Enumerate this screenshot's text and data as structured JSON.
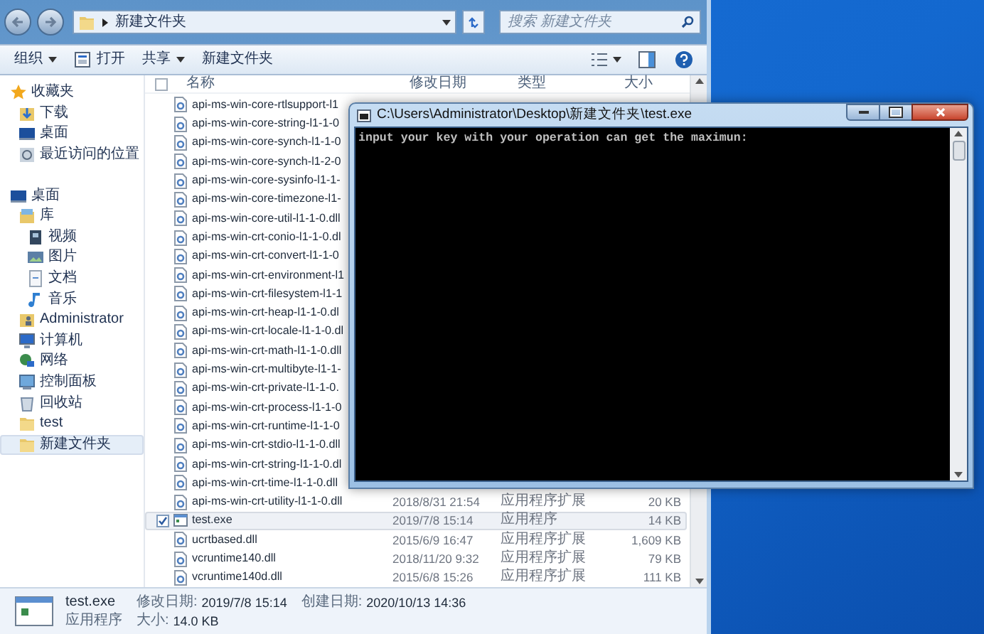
{
  "explorer": {
    "address": {
      "path": [
        "新建文件夹"
      ]
    },
    "search": {
      "placeholder": "搜索 新建文件夹"
    },
    "toolbar": [
      {
        "label": "组织",
        "kind": "menu"
      },
      {
        "label": "打开",
        "kind": "open"
      },
      {
        "label": "共享",
        "kind": "menu"
      },
      {
        "label": "新建文件夹",
        "kind": "plain"
      }
    ],
    "sidebar": [
      {
        "label": "收藏夹",
        "kind": "favorites",
        "selected": false,
        "children": [
          {
            "label": "下载",
            "kind": "downloads",
            "selected": false
          },
          {
            "label": "桌面",
            "kind": "desktop",
            "selected": false
          },
          {
            "label": "最近访问的位置",
            "kind": "recent",
            "selected": false
          }
        ]
      },
      {
        "label": "桌面",
        "kind": "desktop",
        "selected": false,
        "children": [
          {
            "label": "库",
            "kind": "libraries",
            "selected": false,
            "children": [
              {
                "label": "视频",
                "kind": "videos",
                "selected": false
              },
              {
                "label": "图片",
                "kind": "pictures",
                "selected": false
              },
              {
                "label": "文档",
                "kind": "documents",
                "selected": false
              },
              {
                "label": "音乐",
                "kind": "music",
                "selected": false
              }
            ]
          },
          {
            "label": "Administrator",
            "kind": "user",
            "selected": false
          },
          {
            "label": "计算机",
            "kind": "computer",
            "selected": false
          },
          {
            "label": "网络",
            "kind": "network",
            "selected": false
          },
          {
            "label": "控制面板",
            "kind": "control_panel",
            "selected": false
          },
          {
            "label": "回收站",
            "kind": "recycle_bin",
            "selected": false
          },
          {
            "label": "test",
            "kind": "folder",
            "selected": false
          },
          {
            "label": "新建文件夹",
            "kind": "folder",
            "selected": true
          }
        ]
      }
    ],
    "select_all": {
      "checked": false
    },
    "columns": [
      "名称",
      "修改日期",
      "类型",
      "大小"
    ],
    "rows": [
      {
        "name": "api-ms-win-core-rtlsupport-l1",
        "kind": "dll",
        "selected": false
      },
      {
        "name": "api-ms-win-core-string-l1-1-0",
        "kind": "dll",
        "selected": false
      },
      {
        "name": "api-ms-win-core-synch-l1-1-0",
        "kind": "dll",
        "selected": false
      },
      {
        "name": "api-ms-win-core-synch-l1-2-0",
        "kind": "dll",
        "selected": false
      },
      {
        "name": "api-ms-win-core-sysinfo-l1-1-",
        "kind": "dll",
        "selected": false
      },
      {
        "name": "api-ms-win-core-timezone-l1-",
        "kind": "dll",
        "selected": false
      },
      {
        "name": "api-ms-win-core-util-l1-1-0.dll",
        "kind": "dll",
        "selected": false
      },
      {
        "name": "api-ms-win-crt-conio-l1-1-0.dl",
        "kind": "dll",
        "selected": false
      },
      {
        "name": "api-ms-win-crt-convert-l1-1-0",
        "kind": "dll",
        "selected": false
      },
      {
        "name": "api-ms-win-crt-environment-l1",
        "kind": "dll",
        "selected": false
      },
      {
        "name": "api-ms-win-crt-filesystem-l1-1",
        "kind": "dll",
        "selected": false
      },
      {
        "name": "api-ms-win-crt-heap-l1-1-0.dl",
        "kind": "dll",
        "selected": false
      },
      {
        "name": "api-ms-win-crt-locale-l1-1-0.dl",
        "kind": "dll",
        "selected": false
      },
      {
        "name": "api-ms-win-crt-math-l1-1-0.dll",
        "kind": "dll",
        "selected": false
      },
      {
        "name": "api-ms-win-crt-multibyte-l1-1-",
        "kind": "dll",
        "selected": false
      },
      {
        "name": "api-ms-win-crt-private-l1-1-0.",
        "kind": "dll",
        "selected": false
      },
      {
        "name": "api-ms-win-crt-process-l1-1-0",
        "kind": "dll",
        "selected": false
      },
      {
        "name": "api-ms-win-crt-runtime-l1-1-0",
        "kind": "dll",
        "selected": false
      },
      {
        "name": "api-ms-win-crt-stdio-l1-1-0.dll",
        "kind": "dll",
        "selected": false
      },
      {
        "name": "api-ms-win-crt-string-l1-1-0.dl",
        "kind": "dll",
        "selected": false
      },
      {
        "name": "api-ms-win-crt-time-l1-1-0.dll",
        "kind": "dll",
        "selected": false
      },
      {
        "name": "api-ms-win-crt-utility-l1-1-0.dll",
        "kind": "dll",
        "selected": false,
        "date": "2018/8/31 21:54",
        "type": "应用程序扩展",
        "size": "20 KB"
      },
      {
        "name": "test.exe",
        "kind": "exe",
        "selected": true,
        "date": "2019/7/8 15:14",
        "type": "应用程序",
        "size": "14 KB"
      },
      {
        "name": "ucrtbased.dll",
        "kind": "dll",
        "selected": false,
        "date": "2015/6/9 16:47",
        "type": "应用程序扩展",
        "size": "1,609 KB"
      },
      {
        "name": "vcruntime140.dll",
        "kind": "dll",
        "selected": false,
        "date": "2018/11/20 9:32",
        "type": "应用程序扩展",
        "size": "79 KB"
      },
      {
        "name": "vcruntime140d.dll",
        "kind": "dll",
        "selected": false,
        "date": "2015/6/8 15:26",
        "type": "应用程序扩展",
        "size": "111 KB"
      }
    ],
    "details": {
      "name": "test.exe",
      "type": "应用程序",
      "fields": [
        {
          "label": "修改日期:",
          "value": "2019/7/8 15:14"
        },
        {
          "label": "创建日期:",
          "value": "2020/10/13 14:36"
        },
        {
          "label": "大小:",
          "value": "14.0 KB"
        }
      ]
    }
  },
  "console": {
    "title": "C:\\Users\\Administrator\\Desktop\\新建文件夹\\test.exe",
    "lines": [
      "input your key with your operation can get the maximun:"
    ]
  }
}
